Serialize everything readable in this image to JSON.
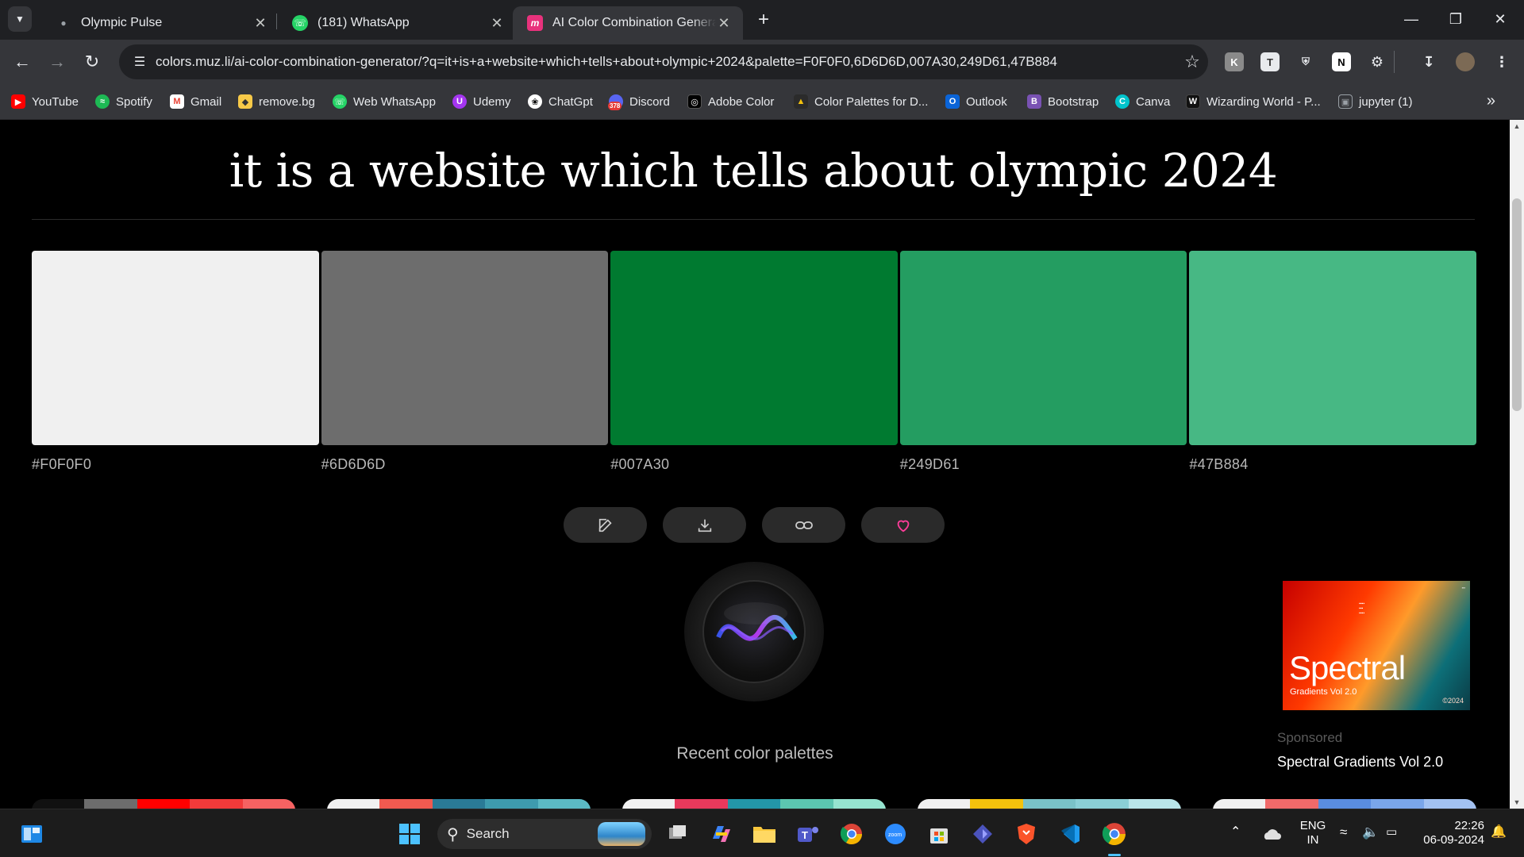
{
  "browser": {
    "tabs": [
      {
        "title": "Olympic Pulse",
        "active": false
      },
      {
        "title": "(181) WhatsApp",
        "active": false
      },
      {
        "title": "AI Color Combination Generator",
        "active": true
      }
    ],
    "url": "colors.muz.li/ai-color-combination-generator/?q=it+is+a+website+which+tells+about+olympic+2024&palette=F0F0F0,6D6D6D,007A30,249D61,47B884",
    "bookmarks": [
      "YouTube",
      "Spotify",
      "Gmail",
      "remove.bg",
      "Web WhatsApp",
      "Udemy",
      "ChatGpt",
      "Discord",
      "Adobe Color",
      "Color Palettes for D...",
      "Outlook",
      "Bootstrap",
      "Canva",
      "Wizarding World - P...",
      "jupyter (1)"
    ],
    "discord_badge": "378"
  },
  "page": {
    "title": "it is a website which tells about olympic 2024",
    "palette": [
      {
        "hex": "#F0F0F0",
        "color": "#F0F0F0"
      },
      {
        "hex": "#6D6D6D",
        "color": "#6D6D6D"
      },
      {
        "hex": "#007A30",
        "color": "#007A30"
      },
      {
        "hex": "#249D61",
        "color": "#249D61"
      },
      {
        "hex": "#47B884",
        "color": "#47B884"
      }
    ],
    "actions": [
      "edit-icon",
      "download-icon",
      "link-icon",
      "heart-icon"
    ],
    "recent_title": "Recent color palettes",
    "recent_palettes": [
      [
        "#111111",
        "#6D6D6D",
        "#FF0000",
        "#F23A3A",
        "#F56262"
      ],
      [
        "#F0F0F0",
        "#F05A50",
        "#2A7A96",
        "#3E9BAE",
        "#5CB9C4"
      ],
      [
        "#F0F0F0",
        "#E8395C",
        "#2396A8",
        "#5CC6B0",
        "#96E4D0"
      ],
      [
        "#F0F0F0",
        "#F4C20D",
        "#7AC2C8",
        "#8BCFD6",
        "#B9E5EA"
      ],
      [
        "#F0F0F0",
        "#F06A6A",
        "#5A8DE0",
        "#7AA6EA",
        "#A3C2F2"
      ]
    ],
    "ad": {
      "brand": "Spectral",
      "subtitle": "Gradients Vol 2.0",
      "year": "©2024",
      "label": "Sponsored",
      "title": "Spectral Gradients Vol 2.0"
    }
  },
  "taskbar": {
    "search_label": "Search",
    "lang_line1": "ENG",
    "lang_line2": "IN",
    "time": "22:26",
    "date": "06-09-2024"
  }
}
